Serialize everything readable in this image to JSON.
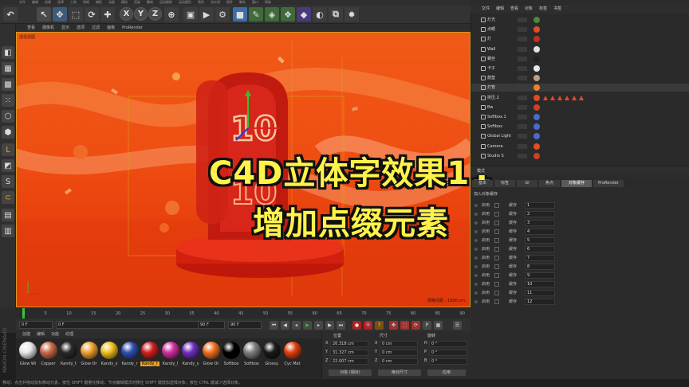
{
  "menubar": {
    "items": [
      "文件",
      "编辑",
      "创建",
      "选择",
      "工具",
      "网格",
      "捕捉",
      "动画",
      "模拟",
      "渲染",
      "雕刻",
      "运动跟踪",
      "运动图形",
      "角色",
      "流水线",
      "插件",
      "脚本",
      "窗口",
      "帮助"
    ]
  },
  "toolbar": {
    "axis_x": "X",
    "axis_y": "Y",
    "axis_z": "Z"
  },
  "viewport": {
    "menu": [
      "查看",
      "摄像机",
      "显示",
      "选项",
      "过滤",
      "面板",
      "ProRender"
    ],
    "label": "透视视图",
    "grid_label": "网格间距 : 1000 cm"
  },
  "overlay": {
    "title_line1": "C4D立体字效果11",
    "title_line2": "增加点缀元素"
  },
  "timeline": {
    "ticks": [
      "0",
      "5",
      "10",
      "15",
      "20",
      "25",
      "30",
      "35",
      "40",
      "45",
      "50",
      "55",
      "60",
      "65",
      "70",
      "75",
      "80",
      "85",
      "90"
    ],
    "start_frame": "0 F",
    "current_frame": "0 F",
    "end_frame": "90 F",
    "end_frame2": "90 F"
  },
  "materials": {
    "menu": [
      "创建",
      "编辑",
      "功能",
      "纹理"
    ],
    "items": [
      {
        "name": "Glow Wi",
        "color": "#e8e8e8"
      },
      {
        "name": "Copper",
        "color": "#c96a4a"
      },
      {
        "name": "Kandy_t",
        "color": "#2a2a2a"
      },
      {
        "name": "Glow Or",
        "color": "#f0a030"
      },
      {
        "name": "Kandy_s",
        "color": "#f0c020"
      },
      {
        "name": "Kandy_r",
        "color": "#3050b0"
      },
      {
        "name": "Kandy_r",
        "color": "#d02020"
      },
      {
        "name": "Kandy_I",
        "color": "#d030a0"
      },
      {
        "name": "Kandy_s",
        "color": "#7030c0"
      },
      {
        "name": "Glow Or",
        "color": "#f07020"
      },
      {
        "name": "Softbox",
        "color": "#000000"
      },
      {
        "name": "Softbox",
        "color": "#808080"
      },
      {
        "name": "Glossy.",
        "color": "#1a1a1a"
      },
      {
        "name": "Cyc Mat",
        "color": "#e04010"
      }
    ],
    "selected_index": 6,
    "brand": "MAXON CINEMA4D"
  },
  "coordinates": {
    "headers": {
      "position": "位置",
      "size": "尺寸",
      "rotation": "旋转"
    },
    "rows": [
      {
        "axis_p": "X",
        "pos": "26.318 cm",
        "axis_s": "X",
        "size": "0 cm",
        "axis_r": "H",
        "rot": "0 °"
      },
      {
        "axis_p": "Y",
        "pos": "31.327 cm",
        "axis_s": "Y",
        "size": "0 cm",
        "axis_r": "P",
        "rot": "0 °"
      },
      {
        "axis_p": "Z",
        "pos": "22.007 cm",
        "axis_s": "Z",
        "size": "0 cm",
        "axis_r": "B",
        "rot": "0 °"
      }
    ],
    "mode1": "对象 (相对)",
    "mode2": "绝对尺寸",
    "apply": "应用"
  },
  "status": {
    "text": "移动：点击并拖动鼠标移动元素。按住 SHIFT 键量化移动；节点编辑模式时按住 SHIFT 键增加选择对象；按住 CTRL 键减少选择对象。"
  },
  "object_manager": {
    "menu": [
      "文件",
      "编辑",
      "查看",
      "对象",
      "标签",
      "书签"
    ],
    "rows": [
      {
        "name": "灯光",
        "tag_color": "#4a8a3a"
      },
      {
        "name": "点眼",
        "tag_color": "#e05020"
      },
      {
        "name": "灯",
        "tag_color": "#c03020"
      },
      {
        "name": "Wall",
        "tag_color": "#e0e0e0"
      },
      {
        "name": "螺丝",
        "tag_color": "#222222"
      },
      {
        "name": "卡子",
        "tag_color": "#e8e8e8"
      },
      {
        "name": "鼓垫",
        "tag_color": "#c0a080"
      },
      {
        "name": "灯管",
        "tag_color": "#f08030"
      },
      {
        "name": "挤压.2",
        "tag_color": "#e04a2a"
      },
      {
        "name": "Bw",
        "tag_color": "#d04020"
      },
      {
        "name": "Softbox.1",
        "tag_color": "#4a6ad0"
      },
      {
        "name": "Softbox",
        "tag_color": "#4a6ad0"
      },
      {
        "name": "Global Light",
        "tag_color": "#4a6ad0"
      },
      {
        "name": "Camera",
        "tag_color": "#e05020"
      },
      {
        "name": "Studio S",
        "tag_color": "#d04020"
      }
    ]
  },
  "attributes": {
    "top_label": "模式",
    "tabs": [
      "基本",
      "标签",
      "GI",
      "焦点",
      "对象缓存",
      "ProRender"
    ],
    "active_tab": "对象缓存",
    "section": "加入对象缓存",
    "enable_label": "启用",
    "buffer_label": "缓存",
    "rows": [
      {
        "value": "1"
      },
      {
        "value": "2"
      },
      {
        "value": "3"
      },
      {
        "value": "4"
      },
      {
        "value": "5"
      },
      {
        "value": "6"
      },
      {
        "value": "7"
      },
      {
        "value": "8"
      },
      {
        "value": "9"
      },
      {
        "value": "10"
      },
      {
        "value": "11"
      },
      {
        "value": "12"
      }
    ]
  }
}
